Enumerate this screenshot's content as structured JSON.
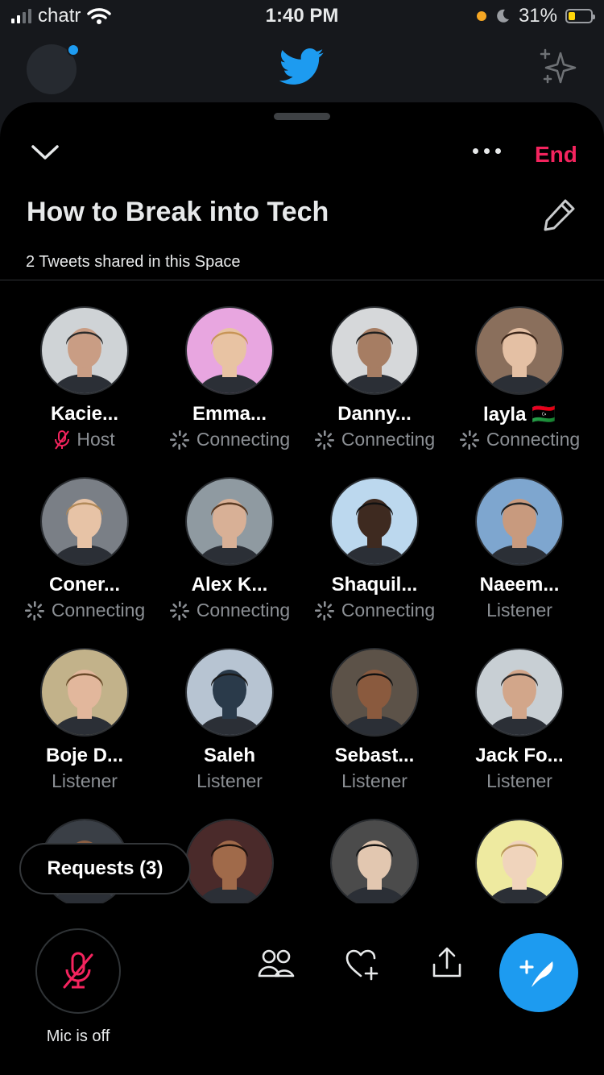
{
  "status_bar": {
    "carrier": "chatr",
    "time": "1:40 PM",
    "battery_percent": "31%",
    "battery_level": 0.31
  },
  "background_header": {
    "logo": "twitter-bird-icon",
    "sparkle": "sparkle-icon"
  },
  "space": {
    "end_label": "End",
    "title": "How to Break into Tech",
    "subtitle": "2 Tweets shared in this Space"
  },
  "participants": [
    {
      "name": "Kacie...",
      "role": "Host",
      "role_icon": "mic-off-icon"
    },
    {
      "name": "Emma...",
      "role": "Connecting",
      "role_icon": "spinner-icon"
    },
    {
      "name": "Danny...",
      "role": "Connecting",
      "role_icon": "spinner-icon"
    },
    {
      "name": "layla 🇱🇾",
      "role": "Connecting",
      "role_icon": "spinner-icon"
    },
    {
      "name": "Coner...",
      "role": "Connecting",
      "role_icon": "spinner-icon"
    },
    {
      "name": "Alex K...",
      "role": "Connecting",
      "role_icon": "spinner-icon"
    },
    {
      "name": "Shaquil...",
      "role": "Connecting",
      "role_icon": "spinner-icon"
    },
    {
      "name": "Naeem...",
      "role": "Listener",
      "role_icon": ""
    },
    {
      "name": "Boje D...",
      "role": "Listener",
      "role_icon": ""
    },
    {
      "name": "Saleh",
      "role": "Listener",
      "role_icon": ""
    },
    {
      "name": "Sebast...",
      "role": "Listener",
      "role_icon": ""
    },
    {
      "name": "Jack Fo...",
      "role": "Listener",
      "role_icon": ""
    },
    {
      "name": "",
      "role": "",
      "role_icon": ""
    },
    {
      "name": "",
      "role": "",
      "role_icon": ""
    },
    {
      "name": "",
      "role": "",
      "role_icon": ""
    },
    {
      "name": "",
      "role": "",
      "role_icon": ""
    }
  ],
  "requests_label": "Requests (3)",
  "bottom_bar": {
    "mic_label": "Mic is off",
    "actions": [
      "people-icon",
      "heart-plus-icon",
      "share-icon",
      "compose-tweet-icon"
    ]
  },
  "colors": {
    "accent": "#1d9bf0",
    "end_red": "#f4245e",
    "muted": "#8b8f94",
    "avatar_backgrounds": [
      "#cfd3d6",
      "#e8a6e0",
      "#d6d8da",
      "#8a6f5c",
      "#7a7f86",
      "#8f9aa1",
      "#bcd8ee",
      "#7ea6cf",
      "#c2b28a",
      "#b7c4d2",
      "#5c5248",
      "#c8cfd4",
      "#3a3f46",
      "#4a2a2a",
      "#4b4b4b",
      "#eeeaa0"
    ],
    "avatar_skin": [
      "#c99d84",
      "#e8c3a3",
      "#a67d63",
      "#e4c0a4",
      "#e7c3a6",
      "#d8b096",
      "#3e2a20",
      "#c89a7e",
      "#e2b79c",
      "#2a3a4a",
      "#8a5a3e",
      "#d2a68a",
      "#8a5f44",
      "#a06a4a",
      "#e2c7b0",
      "#f0d4bc"
    ],
    "avatar_hair": [
      "#2a2a2a",
      "#c79456",
      "#1e1e1e",
      "#3a2418",
      "#b28a5a",
      "#5a3a22",
      "#111111",
      "#222222",
      "#6a4a2a",
      "#1a1a1a",
      "#111111",
      "#2e2a28",
      "#3a2a20",
      "#1e120c",
      "#111111",
      "#b8945a"
    ]
  }
}
